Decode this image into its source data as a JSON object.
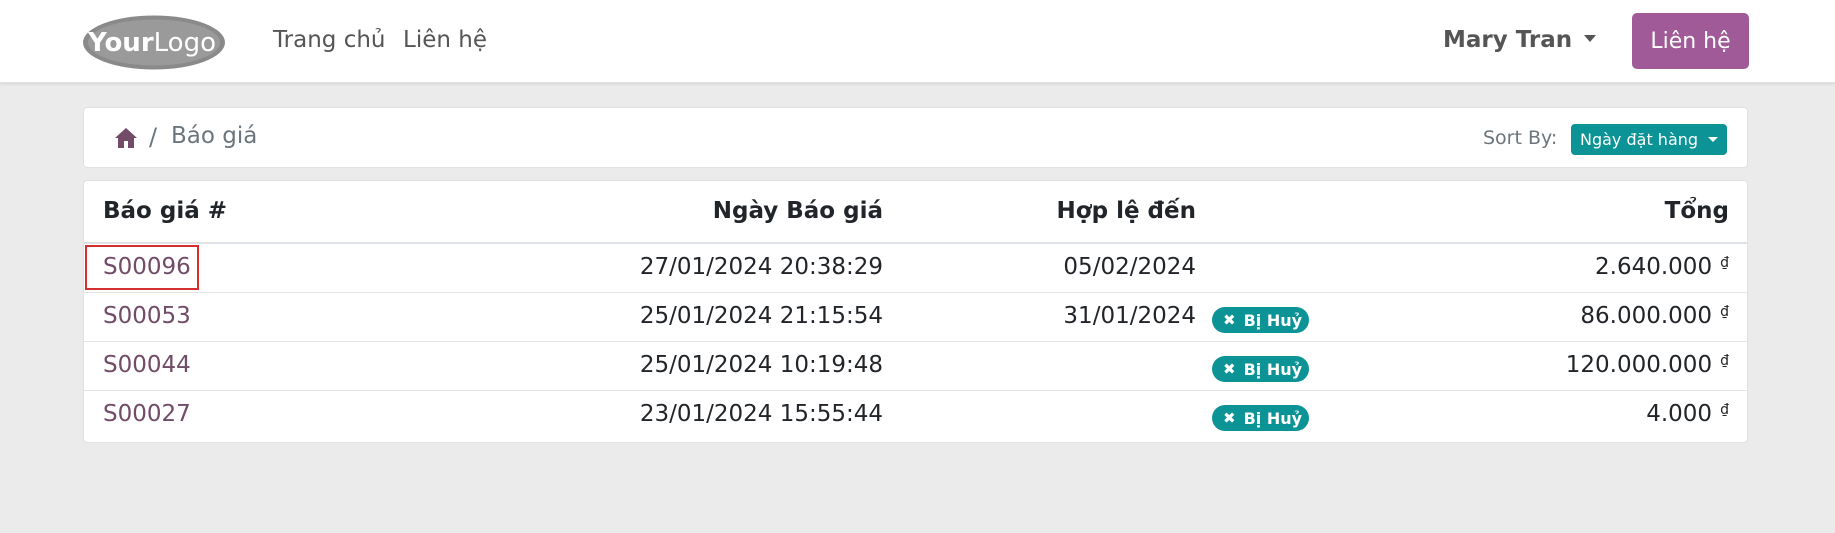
{
  "header": {
    "logo_alt": "YourLogo",
    "nav": [
      {
        "label": "Trang chủ"
      },
      {
        "label": "Liên hệ"
      }
    ],
    "user_name": "Mary Tran",
    "contact_button": "Liên hệ"
  },
  "breadcrumb": {
    "separator": "/",
    "current": "Báo giá"
  },
  "sort": {
    "label": "Sort By:",
    "selected": "Ngày đặt hàng"
  },
  "table": {
    "columns": [
      "Báo giá #",
      "Ngày Báo giá",
      "Hợp lệ đến",
      "Tổng"
    ],
    "rows": [
      {
        "number": "S00096",
        "date": "27/01/2024 20:38:29",
        "valid_until": "05/02/2024",
        "status": "",
        "total": "2.640.000",
        "currency": "₫"
      },
      {
        "number": "S00053",
        "date": "25/01/2024 21:15:54",
        "valid_until": "31/01/2024",
        "status": "Bị Huỷ",
        "total": "86.000.000",
        "currency": "₫"
      },
      {
        "number": "S00044",
        "date": "25/01/2024 10:19:48",
        "valid_until": "",
        "status": "Bị Huỷ",
        "total": "120.000.000",
        "currency": "₫"
      },
      {
        "number": "S00027",
        "date": "23/01/2024 15:55:44",
        "valid_until": "",
        "status": "Bị Huỷ",
        "total": "4.000",
        "currency": "₫"
      }
    ]
  },
  "colors": {
    "brand": "#714b67",
    "button": "#9f5a97",
    "teal": "#0c9396",
    "highlight": "#d32f2f"
  }
}
